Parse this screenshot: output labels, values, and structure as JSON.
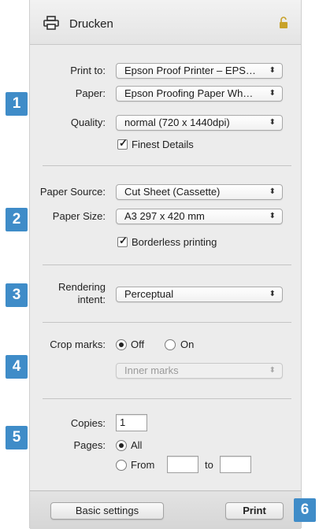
{
  "header": {
    "title": "Drucken",
    "printer_icon": "printer-icon",
    "lock_icon": "unlocked-padlock-icon",
    "lock_color": "#c8a22a"
  },
  "badges": [
    "1",
    "2",
    "3",
    "4",
    "5",
    "6"
  ],
  "badge_color": "#3f8cc8",
  "section1": {
    "print_to_label": "Print to:",
    "print_to_value": "Epson Proof Printer – EPS…",
    "paper_label": "Paper:",
    "paper_value": "Epson Proofing Paper Wh…",
    "quality_label": "Quality:",
    "quality_value": "normal (720 x 1440dpi)",
    "finest_details_label": "Finest Details",
    "finest_details_checked": true
  },
  "section2": {
    "paper_source_label": "Paper Source:",
    "paper_source_value": "Cut Sheet (Cassette)",
    "paper_size_label": "Paper Size:",
    "paper_size_value": "A3 297 x 420 mm",
    "borderless_label": "Borderless printing",
    "borderless_checked": true
  },
  "section3": {
    "rendering_label_line1": "Rendering",
    "rendering_label_line2": "intent:",
    "rendering_value": "Perceptual"
  },
  "section4": {
    "crop_marks_label": "Crop marks:",
    "off_label": "Off",
    "on_label": "On",
    "selected": "Off",
    "marks_value": "Inner marks"
  },
  "section5": {
    "copies_label": "Copies:",
    "copies_value": "1",
    "pages_label": "Pages:",
    "all_label": "All",
    "from_label": "From",
    "to_label": "to",
    "from_value": "",
    "to_value": "",
    "selected": "All"
  },
  "footer": {
    "basic_settings_label": "Basic settings",
    "print_label": "Print"
  }
}
